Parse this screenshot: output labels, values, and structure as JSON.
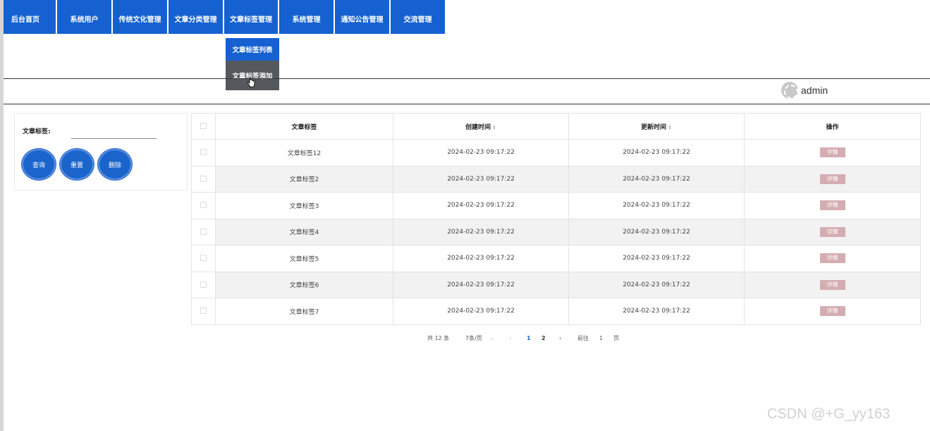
{
  "nav": {
    "items": [
      {
        "label": "后台首页"
      },
      {
        "label": "系统用户"
      },
      {
        "label": "传统文化管理"
      },
      {
        "label": "文章分类管理"
      },
      {
        "label": "文章标签管理"
      },
      {
        "label": "系统管理"
      },
      {
        "label": "通知公告管理"
      },
      {
        "label": "交流管理"
      }
    ],
    "dropdown": {
      "items": [
        {
          "label": "文章标签列表"
        },
        {
          "label": "文章标签添加"
        }
      ]
    }
  },
  "user": {
    "name": "admin",
    "avatar_icon": "avatar-icon"
  },
  "search": {
    "label": "文章标签:",
    "input_value": "",
    "buttons": {
      "query": "查询",
      "reset": "重置",
      "delete": "删除"
    }
  },
  "table": {
    "headers": {
      "tag": "文章标签",
      "create_time": "创建时间",
      "update_time": "更新时间",
      "action": "操作"
    },
    "rows": [
      {
        "tag": "文章标签12",
        "create_time": "2024-02-23 09:17:22",
        "update_time": "2024-02-23 09:17:22",
        "action": "详情"
      },
      {
        "tag": "文章标签2",
        "create_time": "2024-02-23 09:17:22",
        "update_time": "2024-02-23 09:17:22",
        "action": "详情"
      },
      {
        "tag": "文章标签3",
        "create_time": "2024-02-23 09:17:22",
        "update_time": "2024-02-23 09:17:22",
        "action": "详情"
      },
      {
        "tag": "文章标签4",
        "create_time": "2024-02-23 09:17:22",
        "update_time": "2024-02-23 09:17:22",
        "action": "详情"
      },
      {
        "tag": "文章标签5",
        "create_time": "2024-02-23 09:17:22",
        "update_time": "2024-02-23 09:17:22",
        "action": "详情"
      },
      {
        "tag": "文章标签6",
        "create_time": "2024-02-23 09:17:22",
        "update_time": "2024-02-23 09:17:22",
        "action": "详情"
      },
      {
        "tag": "文章标签7",
        "create_time": "2024-02-23 09:17:22",
        "update_time": "2024-02-23 09:17:22",
        "action": "详情"
      }
    ]
  },
  "pagination": {
    "total": "共 12 条",
    "page_size": "7条/页",
    "pages": [
      "1",
      "2"
    ],
    "goto_label": "前往",
    "goto_value": "1",
    "goto_unit": "页"
  },
  "watermark": "CSDN @+G_yy163",
  "colors": {
    "primary": "#1561d1",
    "dropdown_hover": "#55595e",
    "detail_button": "#d4adb2"
  }
}
